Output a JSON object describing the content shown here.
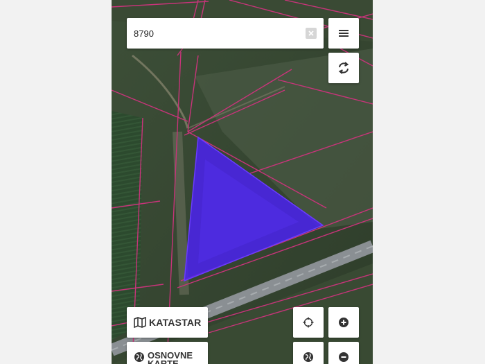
{
  "search": {
    "value": "8790",
    "clear_icon": "clear-x-icon"
  },
  "toolbar": {
    "menu_icon": "hamburger-menu-icon",
    "refresh_icon": "refresh-icon"
  },
  "layers": {
    "katastar_label": "KATASTAR",
    "katastar_icon": "map-fold-icon",
    "osnovne_label": "OSNOVNE KARTE",
    "osnovne_icon": "globe-icon"
  },
  "map_controls": {
    "locate_icon": "crosshair-icon",
    "zoom_in_icon": "plus-circle-icon",
    "zoom_out_icon": "minus-circle-icon",
    "basemap_icon": "globe-icon"
  },
  "colors": {
    "parcel_fill": "#4b22f0",
    "parcel_lines": "#c8347a",
    "road": "#8a8f93",
    "icon": "#333333"
  }
}
